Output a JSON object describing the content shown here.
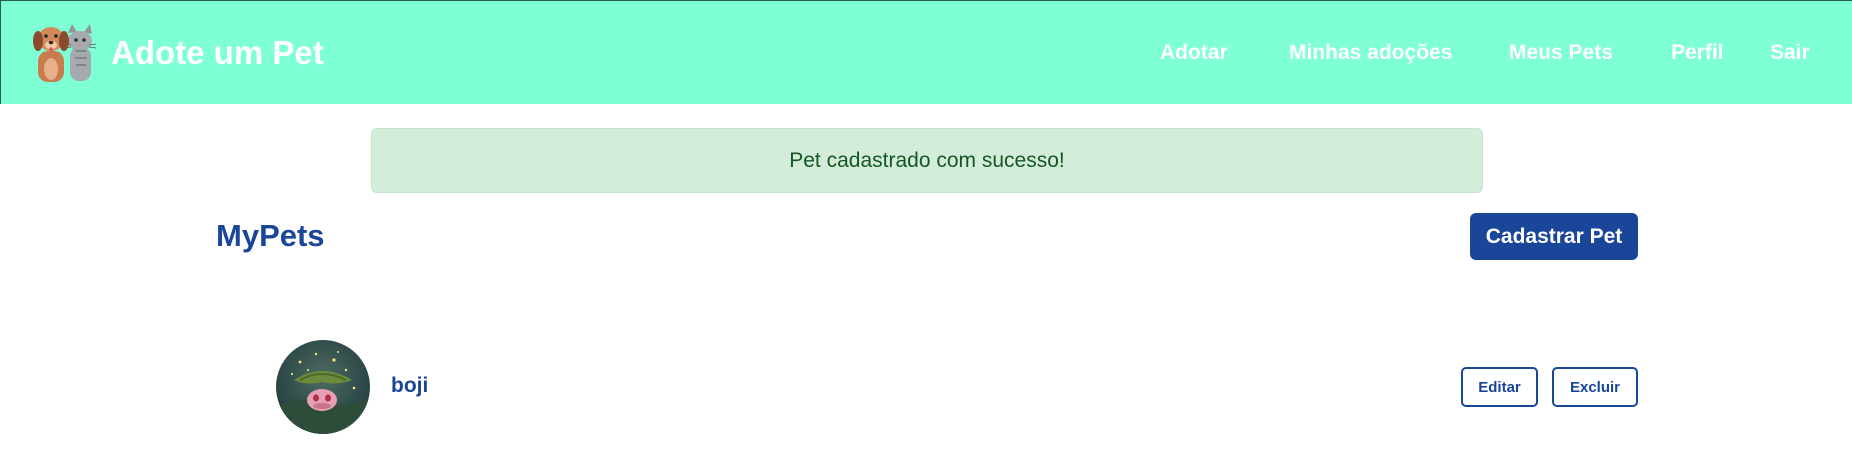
{
  "colors": {
    "navbar_bg": "#7fffd4",
    "primary": "#1a4699",
    "alert_bg": "#d4edda",
    "alert_text": "#155724"
  },
  "navbar": {
    "logo_icon": "dog-and-cat-logo-icon",
    "brand": "Adote um Pet",
    "links": [
      {
        "label": "Adotar"
      },
      {
        "label": "Minhas adoções"
      },
      {
        "label": "Meus Pets"
      },
      {
        "label": "Perfil"
      },
      {
        "label": "Sair"
      }
    ]
  },
  "alert": {
    "message": "Pet cadastrado com sucesso!"
  },
  "page": {
    "title": "MyPets",
    "add_button": "Cadastrar Pet"
  },
  "pets": [
    {
      "name": "boji",
      "avatar_icon": "pet-photo",
      "edit_label": "Editar",
      "delete_label": "Excluir"
    }
  ]
}
